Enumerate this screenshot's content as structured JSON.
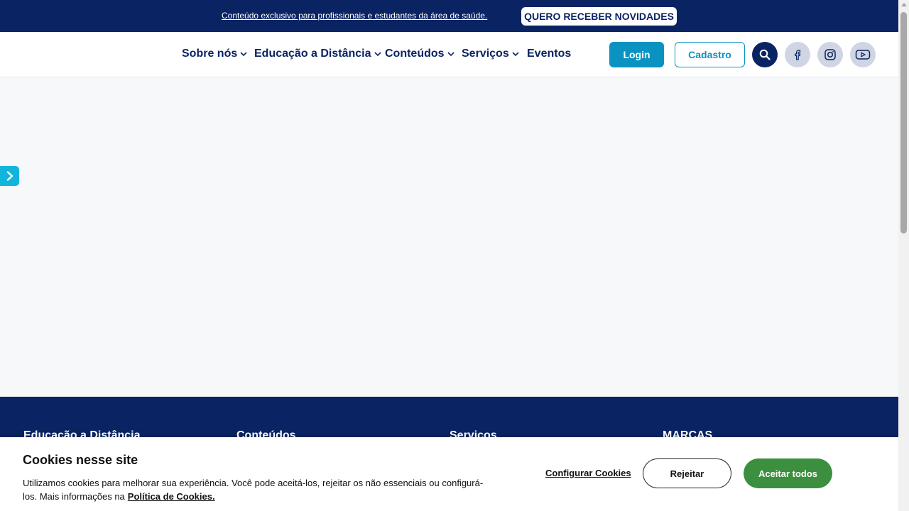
{
  "topbar": {
    "notice_link": "Conteúdo exclusivo para profissionais e estudantes da área de saúde.",
    "cta": "QUERO RECEBER NOVIDADES"
  },
  "nav": {
    "items": [
      {
        "label": "Sobre nós",
        "has_dropdown": true
      },
      {
        "label": "Educação a Distância",
        "has_dropdown": true
      },
      {
        "label": "Conteúdos",
        "has_dropdown": true
      },
      {
        "label": "Serviços",
        "has_dropdown": true
      },
      {
        "label": "Eventos",
        "has_dropdown": false
      }
    ],
    "login": "Login",
    "signup": "Cadastro",
    "icons": [
      "search-icon",
      "facebook-icon",
      "instagram-icon",
      "youtube-icon"
    ]
  },
  "footer": {
    "columns": [
      "Educação a Distância",
      "Conteúdos",
      "Serviços",
      "MARCAS"
    ]
  },
  "cookie": {
    "title": "Cookies nesse site",
    "text": "Utilizamos cookies para melhorar sua experiência. Você pode aceitá-los, rejeitar os não essenciais ou configurá-los. Mais informações na",
    "policy_link": "Política de Cookies.",
    "configure": "Configurar Cookies",
    "reject": "Rejeitar",
    "accept": "Aceitar todos"
  },
  "colors": {
    "navy": "#0a2463",
    "accent_blue": "#0a93c1",
    "cyan": "#11b4db",
    "accept_green": "#3c8f3f"
  }
}
